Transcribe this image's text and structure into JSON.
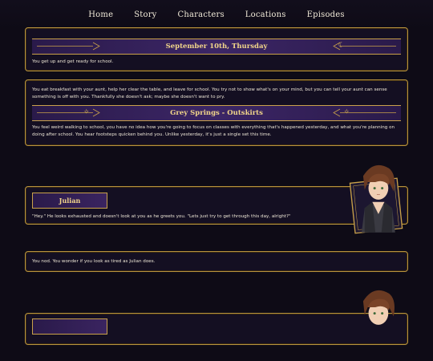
{
  "nav": {
    "items": [
      "Home",
      "Story",
      "Characters",
      "Locations",
      "Episodes"
    ]
  },
  "entries": {
    "date_banner": "September 10th, Thursday",
    "p1": "You get up and get ready for school.",
    "p2": "You eat breakfast with your aunt, help her clear the table, and leave for school. You try not to show what's on your mind, but you can tell your aunt can sense something is off with you. Thankfully she doesn't ask; maybe she doesn't want to pry.",
    "location_banner": "Grey Springs - Outskirts",
    "p3": "You feel weird walking to school, you have no idea how you're going to focus on classes with everything that's happened yesterday, and what you're planning on doing after school. You hear footsteps quicken behind you. Unlike yesterday, it's just a single set this time.",
    "speaker": "Julian",
    "dialogue": "\"Hey.\" He looks exhausted and doesn't look at you as he greets you. \"Lets just try to get through this day, alright?\"",
    "p4": "You nod. You wonder if you look as tired as Julian does."
  },
  "colors": {
    "background": "#0e0b16",
    "card": "#140f22",
    "gold": "#c9a14a",
    "banner_purple": "#3c2666",
    "title_gold": "#f2d68a"
  }
}
